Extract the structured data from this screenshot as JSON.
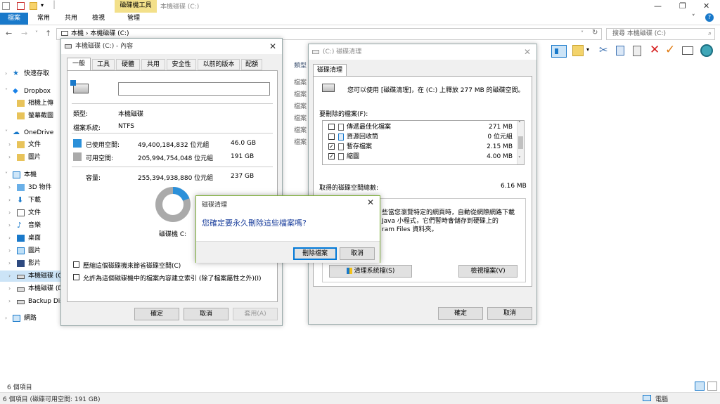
{
  "window": {
    "title": "本機磁碟 (C:)",
    "context_tab": "磁碟機工具",
    "controls": {
      "minimize": "—",
      "maximize": "❐",
      "close": "✕"
    }
  },
  "ribbon": {
    "tabs": [
      "檔案",
      "常用",
      "共用",
      "檢視",
      "管理"
    ]
  },
  "address": {
    "path": "本機 › 本機磁碟 (C:)",
    "search_placeholder": "搜尋 本機磁碟 (C:)"
  },
  "sidebar": {
    "items": [
      {
        "label": "快速存取",
        "icon": "star-icon"
      },
      {
        "label": "Dropbox",
        "icon": "dropbox-icon"
      },
      {
        "label": "相機上傳",
        "icon": "folder-icon"
      },
      {
        "label": "螢幕截圖",
        "icon": "folder-icon"
      },
      {
        "label": "OneDrive",
        "icon": "cloud-icon"
      },
      {
        "label": "文件",
        "icon": "folder-icon"
      },
      {
        "label": "圖片",
        "icon": "folder-icon"
      },
      {
        "label": "本機",
        "icon": "computer-icon"
      },
      {
        "label": "3D 物件",
        "icon": "cube-icon"
      },
      {
        "label": "下載",
        "icon": "download-icon"
      },
      {
        "label": "文件",
        "icon": "document-icon"
      },
      {
        "label": "音樂",
        "icon": "music-icon"
      },
      {
        "label": "桌面",
        "icon": "desktop-icon"
      },
      {
        "label": "圖片",
        "icon": "picture-icon"
      },
      {
        "label": "影片",
        "icon": "video-icon"
      },
      {
        "label": "本機磁碟 (C",
        "icon": "drive-icon"
      },
      {
        "label": "本機磁碟 (D",
        "icon": "drive-icon"
      },
      {
        "label": "Backup Dis",
        "icon": "drive-icon"
      },
      {
        "label": "網路",
        "icon": "network-icon"
      }
    ]
  },
  "status": {
    "items_count": "6 個項目",
    "bottom": "6 個項目 (磁碟可用空間: 191 GB)",
    "computer": "電腦"
  },
  "background_list": {
    "header": "類型",
    "items": [
      "檔案",
      "檔案",
      "檔案",
      "檔案",
      "檔案",
      "檔案"
    ]
  },
  "properties": {
    "title": "本機磁碟 (C:) - 內容",
    "tabs": [
      "一般",
      "工具",
      "硬體",
      "共用",
      "安全性",
      "以前的版本",
      "配額"
    ],
    "type_label": "類型:",
    "type_value": "本機磁碟",
    "fs_label": "檔案系統:",
    "fs_value": "NTFS",
    "used_label": "已使用空間:",
    "used_bytes": "49,400,184,832 位元組",
    "used_gb": "46.0 GB",
    "free_label": "可用空間:",
    "free_bytes": "205,994,754,048 位元組",
    "free_gb": "191 GB",
    "capacity_label": "容量:",
    "capacity_bytes": "255,394,938,880 位元組",
    "capacity_gb": "237 GB",
    "drive_label": "磁碟機 C:",
    "used_fraction": 0.193,
    "compress_label": "壓縮這個磁碟機來節省磁碟空間(C)",
    "index_label": "允許為這個磁碟機中的檔案內容建立索引 (除了檔案屬性之外)(I)",
    "ok": "確定",
    "cancel": "取消",
    "apply": "套用(A)",
    "colors": {
      "used": "#2b90d9",
      "free": "#aaaaaa"
    }
  },
  "cleanup": {
    "title": "(C:) 磁碟清理",
    "tab": "磁碟清理",
    "intro": "您可以使用 [磁碟清理]，在 (C:) 上釋放 277 MB 的磁碟空間。",
    "files_label": "要刪除的檔案(F):",
    "files": [
      {
        "name": "傳遞最佳化檔案",
        "size": "271 MB",
        "checked": false
      },
      {
        "name": "資源回收筒",
        "size": "0 位元組",
        "checked": false
      },
      {
        "name": "暫存檔案",
        "size": "2.15 MB",
        "checked": true
      },
      {
        "name": "縮圖",
        "size": "4.00 MB",
        "checked": true
      }
    ],
    "total_label": "取得的磁碟空間總數:",
    "total_value": "6.16 MB",
    "desc_label": "描述",
    "desc_line1": "些當您瀏覽特定的網頁時，自動從網際網路下載",
    "desc_line2": "Java 小程式，它們暫時會儲存到硬碟上的",
    "desc_line3": "ram Files 資料夾。",
    "clean_system": "清理系統檔(S)",
    "view_files": "檢視檔案(V)",
    "ok": "確定",
    "cancel": "取消"
  },
  "confirm": {
    "title": "磁碟清理",
    "message": "您確定要永久刪除這些檔案嗎?",
    "delete": "刪除檔案",
    "cancel": "取消"
  },
  "colors": {
    "accent": "#1979ca",
    "confirm_border": "#7fb03a"
  }
}
